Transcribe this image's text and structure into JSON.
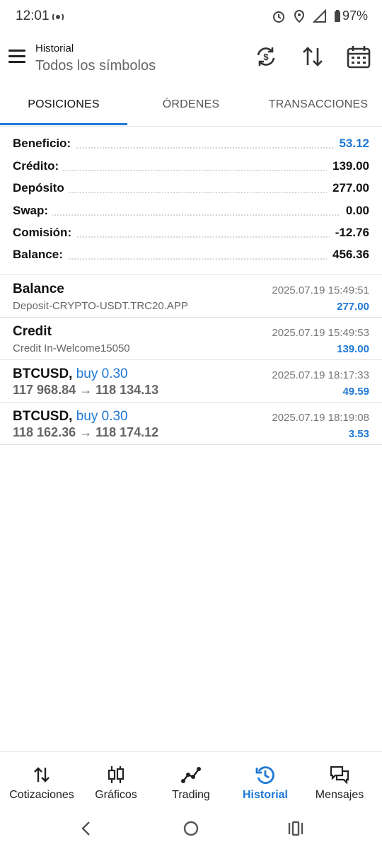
{
  "status_bar": {
    "time": "12:01",
    "battery": "97%"
  },
  "header": {
    "subtitle": "Historial",
    "title": "Todos los símbolos"
  },
  "tabs": [
    {
      "label": "POSICIONES"
    },
    {
      "label": "ÓRDENES"
    },
    {
      "label": "TRANSACCIONES"
    }
  ],
  "summary": [
    {
      "label": "Beneficio:",
      "value": "53.12"
    },
    {
      "label": "Crédito:",
      "value": "139.00"
    },
    {
      "label": "Depósito",
      "value": "277.00"
    },
    {
      "label": "Swap:",
      "value": "0.00"
    },
    {
      "label": "Comisión:",
      "value": "-12.76"
    },
    {
      "label": "Balance:",
      "value": "456.36"
    }
  ],
  "entries": [
    {
      "symbol": "Balance",
      "direction": "",
      "detail": "Deposit-CRYPTO-USDT.TRC20.APP",
      "time": "2025.07.19 15:49:51",
      "amount": "277.00"
    },
    {
      "symbol": "Credit",
      "direction": "",
      "detail": "Credit In-Welcome15050",
      "time": "2025.07.19 15:49:53",
      "amount": "139.00"
    },
    {
      "symbol": "BTCUSD,",
      "direction": "buy 0.30",
      "detail": "117 968.84 → 118 134.13",
      "time": "2025.07.19 18:17:33",
      "amount": "49.59"
    },
    {
      "symbol": "BTCUSD,",
      "direction": "buy 0.30",
      "detail": "118 162.36 → 118 174.12",
      "time": "2025.07.19 18:19:08",
      "amount": "3.53"
    }
  ],
  "bottom_nav": [
    {
      "label": "Cotizaciones",
      "icon": "arrows-up-down-icon"
    },
    {
      "label": "Gráficos",
      "icon": "candlestick-icon"
    },
    {
      "label": "Trading",
      "icon": "trend-line-icon"
    },
    {
      "label": "Historial",
      "icon": "history-icon"
    },
    {
      "label": "Mensajes",
      "icon": "chat-icon"
    }
  ],
  "colors": {
    "accent": "#1e78d6",
    "text": "#111111",
    "muted": "#666666"
  }
}
